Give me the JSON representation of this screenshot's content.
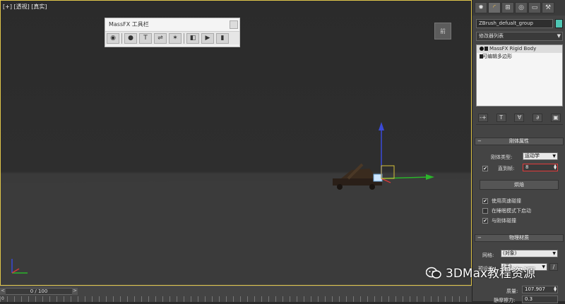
{
  "viewport": {
    "label": "[+] [透视] [真实]",
    "viewcube_label": "前"
  },
  "massfx_toolbar": {
    "title": "MassFX 工具栏",
    "tools": [
      "world-icon",
      "sphere-icon",
      "shirt-icon",
      "constraint-icon",
      "fracture-icon",
      "reset-sim-icon",
      "play-sim-icon",
      "step-sim-icon"
    ]
  },
  "timeline": {
    "slider_label": "0 / 100",
    "start_tick": "0",
    "prev": "<",
    "next": ">"
  },
  "command_panel": {
    "tabs": [
      "create-icon",
      "modify-icon",
      "hierarchy-icon",
      "motion-icon",
      "display-icon",
      "utilities-icon"
    ],
    "object_name": "ZBrush_defualt_group",
    "object_color": "#4ec6b4",
    "modifier_list": "修改器列表",
    "stack": [
      "MassFX Rigid Body",
      "可编辑多边形"
    ],
    "stack_tools": [
      "-+",
      "T",
      "∀",
      "∂",
      "▣"
    ],
    "rigid_rollout": {
      "title": "刚体属性",
      "body_type_label": "刚体类型:",
      "body_type_value": "运动学",
      "until_frame_label": "直到帧:",
      "until_frame_value": "8",
      "until_frame_checked": true,
      "bake_button": "烘焙",
      "options": [
        {
          "label": "使用高速碰撞",
          "checked": true
        },
        {
          "label": "在睡眠模式下启动",
          "checked": false
        },
        {
          "label": "与刚体碰撞",
          "checked": true
        }
      ]
    },
    "physical_rollout": {
      "title": "物理材质",
      "mesh_label": "网格:",
      "mesh_value": "(对象)",
      "preset_label": "预设值:",
      "preset_value": "(无)",
      "mass_label": "质量:",
      "mass_value": "107.907",
      "friction_label": "静摩擦力:",
      "friction_value": "0.3"
    }
  },
  "watermark": "3DMax教程资源"
}
